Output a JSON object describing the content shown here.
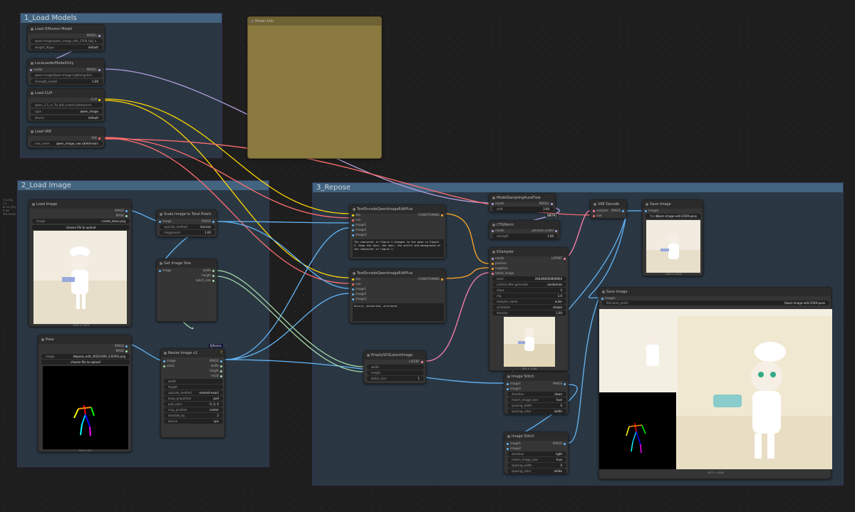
{
  "groups": {
    "models": "1_Load Models",
    "image": "2_Load Image",
    "repose": "3_Repose"
  },
  "side_info": "T: 0.00s\nl: 0\nN: 25 [25]\nV: 64\nFPS:59.88",
  "model_info": {
    "title": "Model Info"
  },
  "load_diffusion": {
    "title": "Load Diffusion Model",
    "out": "MODEL",
    "unet": "qwen-image/qwen_image_edit_2509_fp8_e...",
    "dtype_label": "weight_dtype",
    "dtype": "default"
  },
  "lora": {
    "title": "LoraLoaderModelOnly",
    "in": "model",
    "out": "MODEL",
    "name": "qwen-image/Qwen-Image-Lightning-8st...",
    "strength_label": "strength_model",
    "strength": "1.00"
  },
  "clip": {
    "title": "Load CLIP",
    "out": "CLIP",
    "name": "qwen_2.5_vl_7b_fp8_scaled.safetensors",
    "type_label": "type",
    "type": "qwen_image",
    "device_label": "device",
    "device": "default"
  },
  "vae": {
    "title": "Load VAE",
    "out": "VAE",
    "label": "vae_name",
    "name": "qwen_image_vae.safetensors"
  },
  "load_image": {
    "title": "Load Image",
    "out1": "IMAGE",
    "out2": "MASK",
    "img_label": "image",
    "img": "create_bean.png",
    "upload": "choose file to upload",
    "size": "1024 × 1024"
  },
  "pose": {
    "title": "Pose",
    "out1": "IMAGE",
    "out2": "MASK",
    "img_label": "image",
    "img": "dwpose_edit_20251009_232056.png",
    "upload": "choose file to upload",
    "size": "533 × 917"
  },
  "scale": {
    "title": "Scale Image to Total Pixels",
    "in": "image",
    "out": "IMAGE",
    "method_label": "upscale_method",
    "method": "lanczos",
    "mp_label": "megapixels",
    "mp": "1.00"
  },
  "getsize": {
    "title": "Get Image Size",
    "in": "image",
    "o1": "width",
    "o2": "height",
    "o3": "batch_size"
  },
  "resize": {
    "title": "Resize Image v2",
    "badge": "KJNodes",
    "in1": "image",
    "in2": "mask",
    "o1": "IMAGE",
    "o2": "width",
    "o3": "height",
    "o4": "mask",
    "rows": [
      [
        "width",
        ""
      ],
      [
        "height",
        ""
      ],
      [
        "upscale_method",
        "nearest-exact"
      ],
      [
        "keep_proportion",
        "pad"
      ],
      [
        "pad_color",
        "0, 0, 0"
      ],
      [
        "crop_position",
        "center"
      ],
      [
        "divisible_by",
        "2"
      ],
      [
        "device",
        "cpu"
      ]
    ]
  },
  "enc1": {
    "title": "TextEncodeQwenImageEditPlus",
    "ins": [
      "clip",
      "vae",
      "image1",
      "image2",
      "image3"
    ],
    "out": "CONDITIONING",
    "text": "The character in Figure 1 changes to the pose in Figure 2. Keep the face, the hair, the outfit and background of the character in figure 1."
  },
  "enc2": {
    "title": "TextEncodeQwenImageEditPlus",
    "ins": [
      "clip",
      "vae",
      "image1",
      "image2",
      "image3"
    ],
    "out": "CONDITIONING",
    "text": "blurry, distorted, artifacts"
  },
  "empty": {
    "title": "EmptySD3LatentImage",
    "out": "LATENT",
    "rows": [
      [
        "width",
        ""
      ],
      [
        "height",
        ""
      ],
      [
        "batch_size",
        "1"
      ]
    ]
  },
  "msaf": {
    "title": "ModelSamplingAuraFlow",
    "in": "model",
    "out": "MODEL",
    "shift_label": "shift",
    "shift": "3.00",
    "beta": "[BETA]"
  },
  "cfgnorm": {
    "title": "CFGNorm",
    "in": "model",
    "out": "patched_model",
    "str_label": "strength",
    "str": "1.00"
  },
  "ksampler": {
    "title": "KSampler",
    "ins": [
      "model",
      "positive",
      "negative",
      "latent_image"
    ],
    "out": "LATENT",
    "rows": [
      [
        "seed",
        "264490650890850"
      ],
      [
        "control after generate",
        "randomize"
      ],
      [
        "steps",
        "4"
      ],
      [
        "cfg",
        "1.0"
      ],
      [
        "sampler_name",
        "euler"
      ],
      [
        "scheduler",
        "simple"
      ],
      [
        "denoise",
        "1.00"
      ]
    ],
    "size": "832 × 1248"
  },
  "vaedec": {
    "title": "VAE Decode",
    "in1": "samples",
    "in2": "vae",
    "out": "IMAGE"
  },
  "save1": {
    "title": "Save Image",
    "in": "images",
    "fn_label": "filena",
    "fn": "Qwen-image-edit-2509-pose",
    "size": "1024 × 1024"
  },
  "save2": {
    "title": "Save Image",
    "in": "images",
    "fn_label": "filename_prefix",
    "fn": "Qwen-image-edit-2509-pose",
    "size": "3072 × 2048"
  },
  "stitch1": {
    "title": "Image Stitch",
    "in1": "image1",
    "in2": "image2",
    "out": "IMAGE",
    "rows": [
      [
        "direction",
        "down"
      ],
      [
        "match_image_size",
        "true"
      ],
      [
        "spacing_width",
        "0"
      ],
      [
        "spacing_color",
        "white"
      ]
    ]
  },
  "stitch2": {
    "title": "Image Stitch",
    "in1": "image1",
    "in2": "image2",
    "out": "IMAGE",
    "rows": [
      [
        "direction",
        "right"
      ],
      [
        "match_image_size",
        "true"
      ],
      [
        "spacing_width",
        "0"
      ],
      [
        "spacing_color",
        "white"
      ]
    ]
  }
}
